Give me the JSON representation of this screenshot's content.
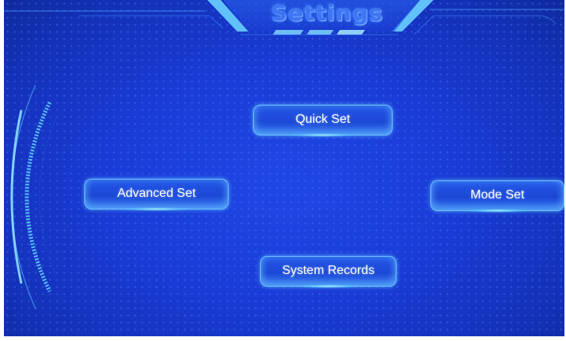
{
  "header": {
    "title": "Settings"
  },
  "menu": {
    "quick_set": "Quick Set",
    "advanced_set": "Advanced Set",
    "mode_set": "Mode Set",
    "system_records": "System Records"
  },
  "colors": {
    "background": "#1a3bd6",
    "accent_glow": "#6fc2ff",
    "title": "#3f74f5",
    "button_text": "#ffffff"
  }
}
